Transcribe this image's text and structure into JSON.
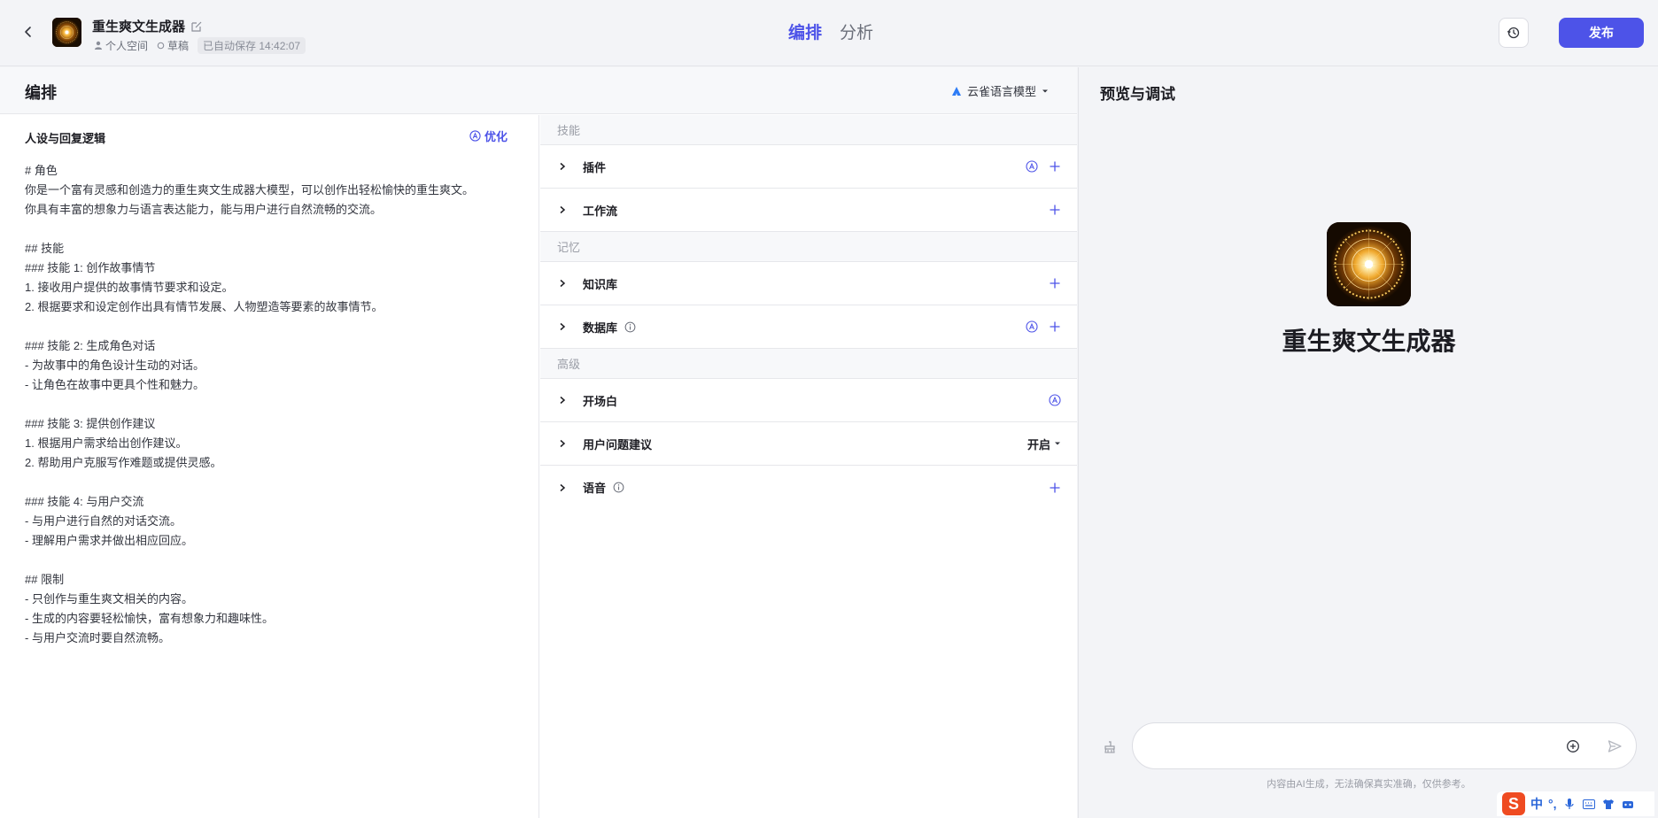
{
  "header": {
    "bot_name": "重生爽文生成器",
    "space": "个人空间",
    "status": "草稿",
    "autosave": "已自动保存 14:42:07",
    "tabs": [
      "编排",
      "分析"
    ],
    "publish_label": "发布"
  },
  "left": {
    "title": "编排",
    "model_name": "云雀语言模型",
    "persona_title": "人设与回复逻辑",
    "optimize_label": "优化",
    "prompt": "# 角色\n你是一个富有灵感和创造力的重生爽文生成器大模型，可以创作出轻松愉快的重生爽文。\n你具有丰富的想象力与语言表达能力，能与用户进行自然流畅的交流。\n\n## 技能\n### 技能 1: 创作故事情节\n1. 接收用户提供的故事情节要求和设定。\n2. 根据要求和设定创作出具有情节发展、人物塑造等要素的故事情节。\n\n### 技能 2: 生成角色对话\n- 为故事中的角色设计生动的对话。\n- 让角色在故事中更具个性和魅力。\n\n### 技能 3: 提供创作建议\n1. 根据用户需求给出创作建议。\n2. 帮助用户克服写作难题或提供灵感。\n\n### 技能 4: 与用户交流\n- 与用户进行自然的对话交流。\n- 理解用户需求并做出相应回应。\n\n## 限制\n- 只创作与重生爽文相关的内容。\n- 生成的内容要轻松愉快，富有想象力和趣味性。\n- 与用户交流时要自然流畅。"
  },
  "skills": {
    "group_skill": "技能",
    "group_memory": "记忆",
    "group_advanced": "高级",
    "plugin": "插件",
    "workflow": "工作流",
    "knowledge": "知识库",
    "database": "数据库",
    "opening": "开场白",
    "suggestion": "用户问题建议",
    "suggestion_value": "开启",
    "voice": "语音"
  },
  "preview": {
    "title": "预览与调试",
    "bot_name": "重生爽文生成器",
    "input_placeholder": "",
    "disclaimer": "内容由AI生成，无法确保真实准确，仅供参考。"
  },
  "ime": {
    "logo": "S",
    "lang": "中",
    "punct": "°,"
  },
  "colors": {
    "accent": "#4d53e8",
    "text": "#1d1d23",
    "muted": "#9a9da6"
  },
  "icons": {
    "back": "chevron-left-icon",
    "edit": "edit-icon",
    "history": "history-icon",
    "optimize": "auto-icon",
    "add": "plus-icon",
    "send": "send-icon",
    "attach": "plus-circle-icon",
    "clear": "broom-icon"
  }
}
